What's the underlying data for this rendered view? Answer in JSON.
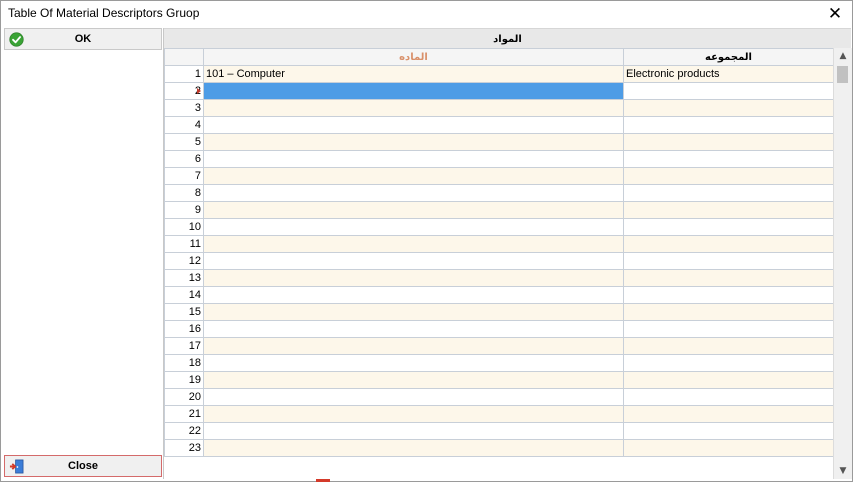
{
  "window": {
    "title": "Table Of Material Descriptors Gruop",
    "close_glyph": "✕"
  },
  "side": {
    "ok_label": "OK",
    "ok_icon": "check-circle-icon",
    "close_label": "Close",
    "close_icon": "exit-door-icon"
  },
  "grid": {
    "group_header": "المواد",
    "columns": {
      "material": "الماده",
      "group": "المجموعه"
    },
    "rows": [
      {
        "num": "1",
        "material": "101 – Computer",
        "group": "Electronic products"
      },
      {
        "num": "2",
        "material": "",
        "group": ""
      },
      {
        "num": "3",
        "material": "",
        "group": ""
      },
      {
        "num": "4",
        "material": "",
        "group": ""
      },
      {
        "num": "5",
        "material": "",
        "group": ""
      },
      {
        "num": "6",
        "material": "",
        "group": ""
      },
      {
        "num": "7",
        "material": "",
        "group": ""
      },
      {
        "num": "8",
        "material": "",
        "group": ""
      },
      {
        "num": "9",
        "material": "",
        "group": ""
      },
      {
        "num": "10",
        "material": "",
        "group": ""
      },
      {
        "num": "11",
        "material": "",
        "group": ""
      },
      {
        "num": "12",
        "material": "",
        "group": ""
      },
      {
        "num": "13",
        "material": "",
        "group": ""
      },
      {
        "num": "14",
        "material": "",
        "group": ""
      },
      {
        "num": "15",
        "material": "",
        "group": ""
      },
      {
        "num": "16",
        "material": "",
        "group": ""
      },
      {
        "num": "17",
        "material": "",
        "group": ""
      },
      {
        "num": "18",
        "material": "",
        "group": ""
      },
      {
        "num": "19",
        "material": "",
        "group": ""
      },
      {
        "num": "20",
        "material": "",
        "group": ""
      },
      {
        "num": "21",
        "material": "",
        "group": ""
      },
      {
        "num": "22",
        "material": "",
        "group": ""
      },
      {
        "num": "23",
        "material": "",
        "group": ""
      }
    ],
    "active_row": 2
  },
  "colors": {
    "odd_row": "#fdf7ea",
    "selection": "#4e9ce6",
    "material_header": "#d9906a"
  }
}
